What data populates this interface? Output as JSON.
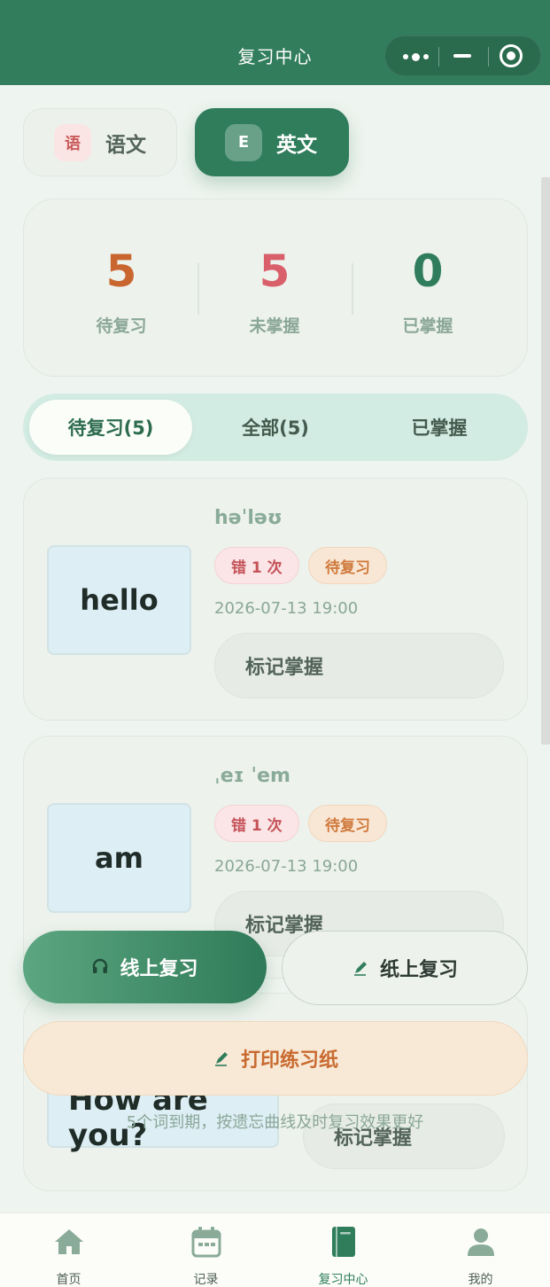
{
  "header": {
    "title": "复习中心",
    "capsule": {
      "more_icon": "more-dots-icon",
      "minimize_icon": "minimize-icon",
      "close_icon": "target-close-icon"
    }
  },
  "language_tabs": [
    {
      "badge": "语",
      "label": "语文",
      "active": false
    },
    {
      "badge": "E",
      "label": "英文",
      "active": true
    }
  ],
  "stats": [
    {
      "value": "5",
      "label": "待复习",
      "color": "#c9662f"
    },
    {
      "value": "5",
      "label": "未掌握",
      "color": "#d9606a"
    },
    {
      "value": "0",
      "label": "已掌握",
      "color": "#2f7d5b"
    }
  ],
  "filter_tabs": [
    {
      "label": "待复习(5)",
      "active": true
    },
    {
      "label": "全部(5)",
      "active": false
    },
    {
      "label": "已掌握",
      "active": false
    }
  ],
  "cards": [
    {
      "word": "hello",
      "phonetic": "həˈləʊ",
      "error_tag": "错 1 次",
      "status_tag": "待复习",
      "date": "2026-07-13 19:00",
      "action": "标记掌握"
    },
    {
      "word": "am",
      "phonetic": "ˌeɪ ˈem",
      "error_tag": "错 1 次",
      "status_tag": "待复习",
      "date": "2026-07-13 19:00",
      "action": "标记掌握"
    },
    {
      "word": "How are you?",
      "action": "标记掌握"
    }
  ],
  "actions": {
    "online_review": "线上复习",
    "online_icon": "headphones-icon",
    "paper_review": "纸上复习",
    "paper_icon": "pencil-icon",
    "print_sheet": "打印练习纸",
    "print_icon": "pencil-icon",
    "hint": "5个词到期，按遗忘曲线及时复习效果更好"
  },
  "tabbar": [
    {
      "label": "首页",
      "icon": "home-icon",
      "active": false
    },
    {
      "label": "记录",
      "icon": "calendar-icon",
      "active": false
    },
    {
      "label": "复习中心",
      "icon": "book-icon",
      "active": true
    },
    {
      "label": "我的",
      "icon": "user-icon",
      "active": false
    }
  ],
  "colors": {
    "brand_green": "#2f7d5b",
    "header_green": "#327e5c",
    "background": "#eef4ef",
    "orange": "#c9662f",
    "red": "#d9606a"
  }
}
